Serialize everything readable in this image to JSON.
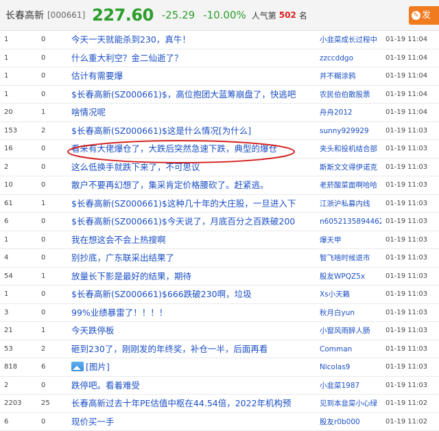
{
  "header": {
    "name": "长春高新",
    "code": "[000661]",
    "price": "227.60",
    "change": "-25.29",
    "change_pct": "-10.00%",
    "popularity_label": "人气第",
    "popularity_rank": "502",
    "popularity_unit": "名",
    "post_label": "发"
  },
  "posts": [
    {
      "reads": "1",
      "replies": "0",
      "title": "今天一天就能杀到230，真牛！",
      "author": "小韭菜成长过程中",
      "date": "01-19 11:04"
    },
    {
      "reads": "1",
      "replies": "0",
      "title": "什么重大利空？金二仙逝了？",
      "author": "zzccddgo",
      "date": "01-19 11:04"
    },
    {
      "reads": "1",
      "replies": "0",
      "title": "估计有需要爆",
      "author": "并不糊涂鸦",
      "date": "01-19 11:04"
    },
    {
      "reads": "1",
      "replies": "0",
      "title": "$长春高新(SZ000661)$，高位抱团大蓝筹崩盘了，快逃吧",
      "author": "农民伯伯散股票",
      "date": "01-19 11:04"
    },
    {
      "reads": "20",
      "replies": "1",
      "title": "啥情况呢",
      "author": "舟舟2012",
      "date": "01-19 11:04"
    },
    {
      "reads": "153",
      "replies": "2",
      "title": "$长春高新(SZ000661)$这是什么情况[为什么]",
      "author": "sunny929929",
      "date": "01-19 11:03"
    },
    {
      "reads": "16",
      "replies": "0",
      "title": "看来有大佬爆仓了，大跌后突然急速下跌，典型的爆仓",
      "author": "夹头和投机结合部",
      "date": "01-19 11:03"
    },
    {
      "reads": "2",
      "replies": "0",
      "title": "这么低换手就跌下来了，不可思议",
      "author": "斯斯文文得伊诺克",
      "date": "01-19 11:03"
    },
    {
      "reads": "10",
      "replies": "0",
      "title": "散户不要再幻想了，集采肯定价格腰砍了。赶紧逃。",
      "author": "老菸酸菜面啊哈哈",
      "date": "01-19 11:03"
    },
    {
      "reads": "61",
      "replies": "1",
      "title": "$长春高新(SZ000661)$这种几十年的大庄股，一旦进入下",
      "author": "江浙沪私募内线",
      "date": "01-19 11:03"
    },
    {
      "reads": "6",
      "replies": "0",
      "title": "$长春高新(SZ000661)$今天说了，月底百分之百跌破200",
      "author": "n605213589446210",
      "date": "01-19 11:03"
    },
    {
      "reads": "1",
      "replies": "0",
      "title": "我在想这会不会上热搜啊",
      "author": "爆天甲",
      "date": "01-19 11:03"
    },
    {
      "reads": "4",
      "replies": "0",
      "title": "别抄底，广东联采出结果了",
      "author": "智飞啥时候退市",
      "date": "01-19 11:03"
    },
    {
      "reads": "54",
      "replies": "1",
      "title": "放量长下影是最好的结果，期待",
      "author": "股友WPQZ5x",
      "date": "01-19 11:03"
    },
    {
      "reads": "1",
      "replies": "0",
      "title": "$长春高新(SZ000661)$666跌破230啊，垃圾",
      "author": "Xs小天籁",
      "date": "01-19 11:03"
    },
    {
      "reads": "3",
      "replies": "0",
      "title": "99%业绩暴雷了！！！！",
      "author": "秋月白yun",
      "date": "01-19 11:03"
    },
    {
      "reads": "21",
      "replies": "1",
      "title": "今天跌停板",
      "author": "小窗风雨醉人肠",
      "date": "01-19 11:03"
    },
    {
      "reads": "53",
      "replies": "2",
      "title": "砸到230了，刚刚发的年终奖，补仓一半，后面再看",
      "author": "Comman",
      "date": "01-19 11:03"
    },
    {
      "reads": "818",
      "replies": "6",
      "title": "[图片]",
      "has_image": true,
      "author": "Nicolas9",
      "date": "01-19 11:03"
    },
    {
      "reads": "2",
      "replies": "0",
      "title": "跌停吧。看着难受",
      "author": "小韭菜1987",
      "date": "01-19 11:03"
    },
    {
      "reads": "2203",
      "replies": "25",
      "title": "长春高新过去十年PE估值中枢在44.54倍，2022年机构预",
      "author": "见到本韭菜小心绿",
      "date": "01-19 11:02"
    },
    {
      "reads": "6",
      "replies": "0",
      "title": "现价买一手",
      "author": "股友r0b000",
      "date": "01-19 11:02"
    }
  ],
  "colors": {
    "price_down": "#2a9d2a",
    "link": "#1a4ec4",
    "accent": "#f07a1e",
    "annotation": "#d42020"
  }
}
